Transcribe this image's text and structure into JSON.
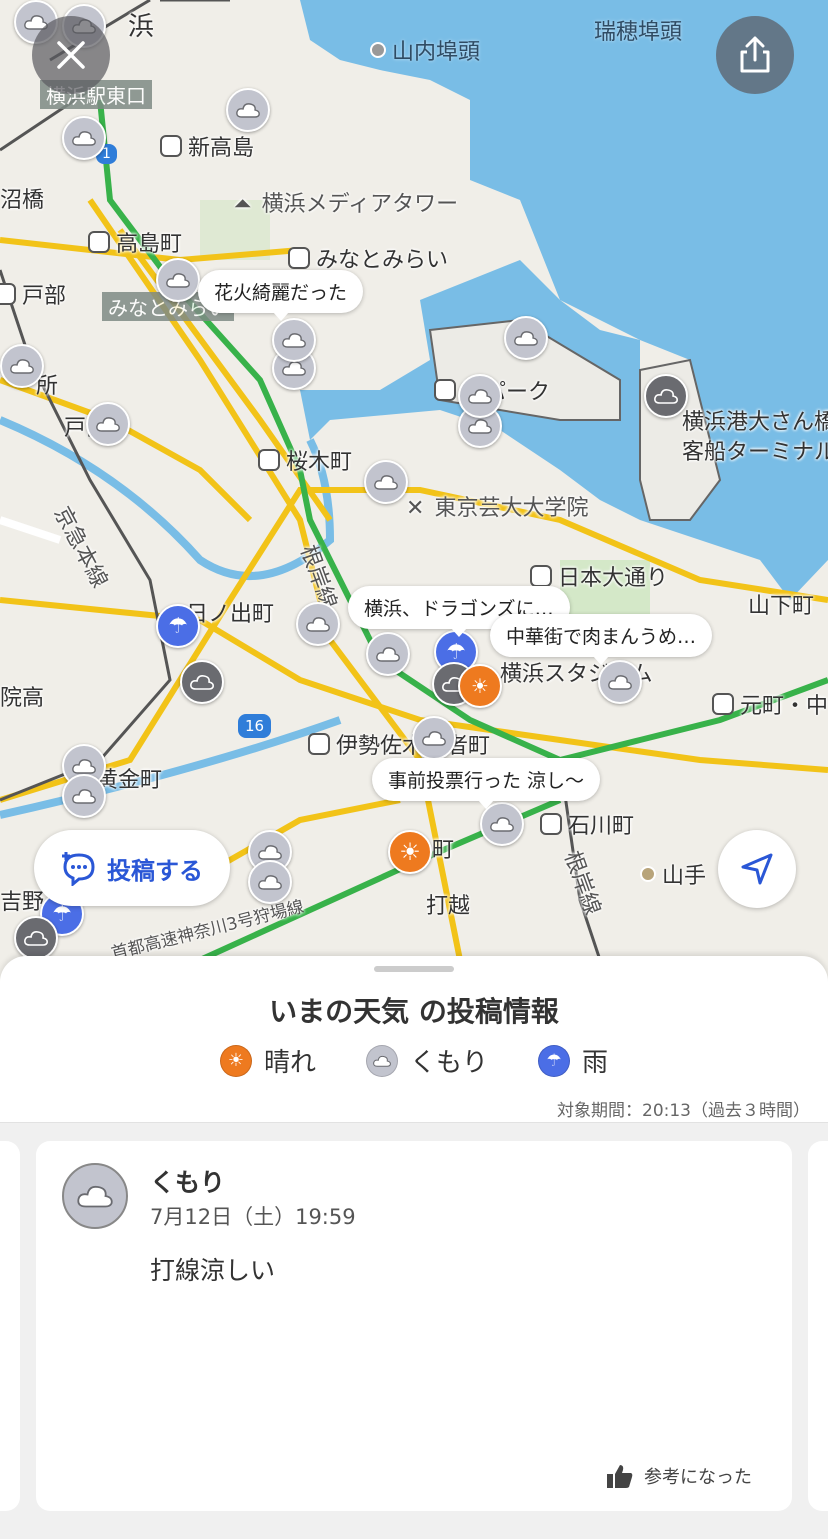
{
  "map": {
    "labels": {
      "hama": "浜",
      "mizuho": "瑞穂埠頭",
      "yamanouchi": "山内埠頭",
      "yokohama_east": "横浜駅東口",
      "shintakashima": "新高島",
      "route1": "1",
      "bashi": "沼橋",
      "media_tower": "横浜メディアタワー",
      "takashimacho": "高島町",
      "minatomirai": "みなとみらい",
      "tobe": "戸部",
      "minatomirai2": "みなとみらい",
      "tokoro": "所",
      "park": "河パーク",
      "osanbashi": "横浜港大さん橋",
      "terminal": "客船ターミナル",
      "tobe2": "戸部",
      "sakuragicho": "桜木町",
      "keikyu": "京急本線",
      "geidai": "東京芸大大学院",
      "negishi_line": "根岸線",
      "nihon_odori": "日本大通り",
      "yamashita": "山下町",
      "hinodecho": "日ノ出町",
      "yokohama_stadium": "横浜スタジアム",
      "motomachi": "元町・中",
      "inkou": "院高",
      "route16": "16",
      "isezaki": "伊勢佐木長者町",
      "koganecho": "黄金町",
      "ishikawacho": "石川町",
      "machi": "町",
      "yamate": "山手",
      "yoshino": "吉野",
      "route3": "首都高速神奈川3号狩場線",
      "uchikoshi": "打越",
      "negishi_line2": "根岸線"
    },
    "bubbles": {
      "hanabi": "花火綺麗だった",
      "dragons": "横浜、ドラゴンズに…",
      "chukagai": "中華街で肉まんうめ…",
      "jizen": "事前投票行った 涼し〜"
    },
    "post_button": "投稿する",
    "icons": {
      "close": "close-icon",
      "share": "share-icon",
      "locate": "location-arrow-icon",
      "post": "post-bubble-icon"
    }
  },
  "sheet": {
    "title": "いまの天気 の投稿情報",
    "legend": {
      "sunny": "晴れ",
      "cloudy": "くもり",
      "rain": "雨"
    },
    "period": "対象期間：20:13（過去３時間）",
    "post": {
      "weather": "くもり",
      "date": "7月12日（土）19:59",
      "body": "打線涼しい",
      "helpful": "参考になった"
    }
  },
  "colors": {
    "sea": "#79bde6",
    "sunny": "#ee7a1f",
    "cloudy": "#c2c4ce",
    "rain": "#4b6ee6",
    "accent": "#2a57d6",
    "rail_green": "#38b24a",
    "road_yellow": "#f2c318"
  }
}
